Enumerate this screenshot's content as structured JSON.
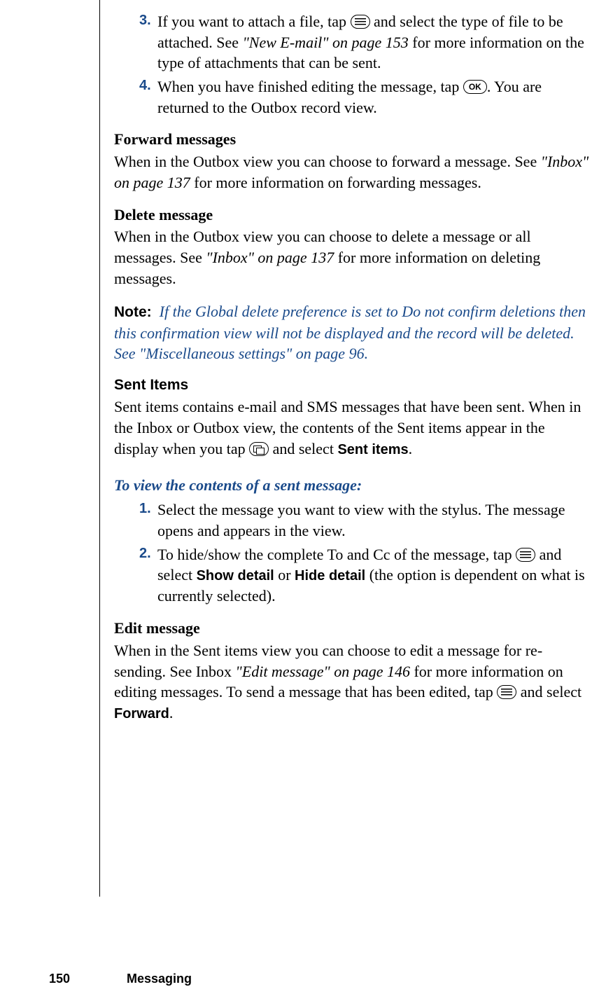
{
  "steps_top": [
    {
      "num": "3.",
      "before": "If you want to attach a file, tap ",
      "after": " and select the type of file to be attached. See ",
      "ref": "\"New E-mail\" on page 153",
      "tail": " for more information on the type of attachments that can be sent."
    },
    {
      "num": "4.",
      "before": "When you have finished editing the message, tap ",
      "after": ". You are returned to the Outbox record view."
    }
  ],
  "forward": {
    "heading": "Forward messages",
    "before": "When in the Outbox view you can choose to forward a message. See ",
    "ref": "\"Inbox\" on page 137",
    "after": " for more information on forwarding messages."
  },
  "delete": {
    "heading": "Delete message",
    "before": "When in the Outbox view you can choose to delete a message or all messages. See ",
    "ref": "\"Inbox\" on page 137",
    "after": " for more information on deleting messages."
  },
  "note": {
    "label": "Note:",
    "body": "If the Global delete preference is set to Do not confirm deletions then this confirmation view will not be displayed and the record will be deleted. See \"Miscellaneous settings\" on page 96."
  },
  "sent": {
    "heading": "Sent Items",
    "before": "Sent items contains e-mail and SMS messages that have been sent. When in the Inbox or Outbox view, the contents of the Sent items appear in the display when you tap ",
    "after": " and select ",
    "ui_label": "Sent items",
    "period": "."
  },
  "view_heading": "To view the contents of a sent message:",
  "steps_view": [
    {
      "num": "1.",
      "text": "Select the message you want to view with the stylus. The message opens and appears in the view."
    },
    {
      "num": "2.",
      "before": "To hide/show the complete To and Cc of the message, tap ",
      "mid": " and select ",
      "ui1": "Show detail",
      "or": " or ",
      "ui2": "Hide detail",
      "after": " (the option is dependent on what is currently selected)."
    }
  ],
  "edit": {
    "heading": "Edit message",
    "before": "When in the Sent items view you can choose to edit a message for re-sending. See Inbox ",
    "ref": "\"Edit message\" on page 146",
    "mid": " for more information on editing messages. To send a message that has been edited, tap ",
    "after": " and select ",
    "ui_label": "Forward",
    "period": "."
  },
  "footer": {
    "page": "150",
    "chapter": "Messaging"
  },
  "icons": {
    "ok": "OK"
  }
}
